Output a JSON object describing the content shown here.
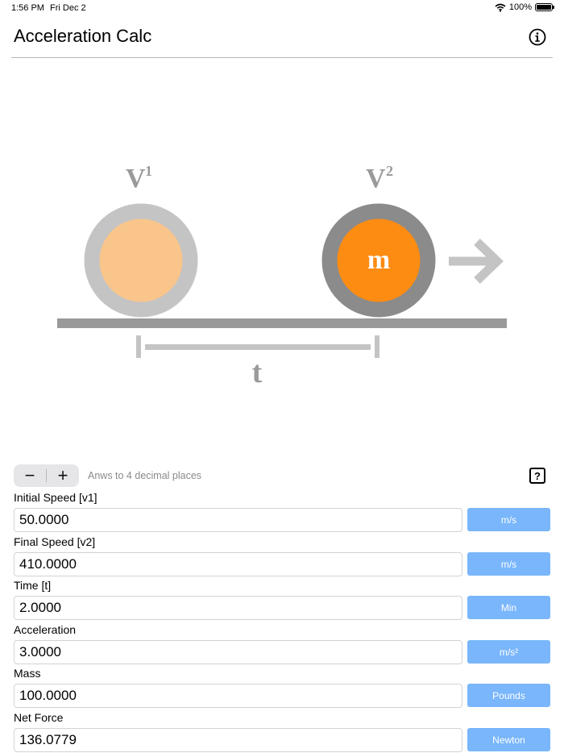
{
  "status_bar": {
    "time": "1:56 PM",
    "date": "Fri Dec 2",
    "battery": "100%"
  },
  "nav": {
    "title": "Acceleration Calc"
  },
  "illustration": {
    "v1_label": "V",
    "v1_sup": "1",
    "v2_label": "V",
    "v2_sup": "2",
    "mass_label": "m",
    "time_label": "t",
    "colors": {
      "ball1_fill": "#f9c58b",
      "ball1_ring": "#c4c4c4",
      "ball2_fill": "#fd8c13",
      "ball2_ring": "#8b8b8b",
      "track": "#999999",
      "arrow": "#c4c4c4"
    }
  },
  "controls": {
    "decrement_label": "−",
    "increment_label": "+",
    "precision_text": "Anws to 4 decimal places",
    "help_label": "?"
  },
  "fields": [
    {
      "label": "Initial Speed [v1]",
      "value": "50.0000",
      "unit": "m/s"
    },
    {
      "label": "Final Speed [v2]",
      "value": "410.0000",
      "unit": "m/s"
    },
    {
      "label": "Time [t]",
      "value": "2.0000",
      "unit": "Min"
    },
    {
      "label": "Acceleration",
      "value": "3.0000",
      "unit": "m/s²"
    },
    {
      "label": "Mass",
      "value": "100.0000",
      "unit": "Pounds"
    },
    {
      "label": "Net Force",
      "value": "136.0779",
      "unit": "Newton"
    }
  ],
  "colors": {
    "unit_button": "#79b6fb"
  }
}
